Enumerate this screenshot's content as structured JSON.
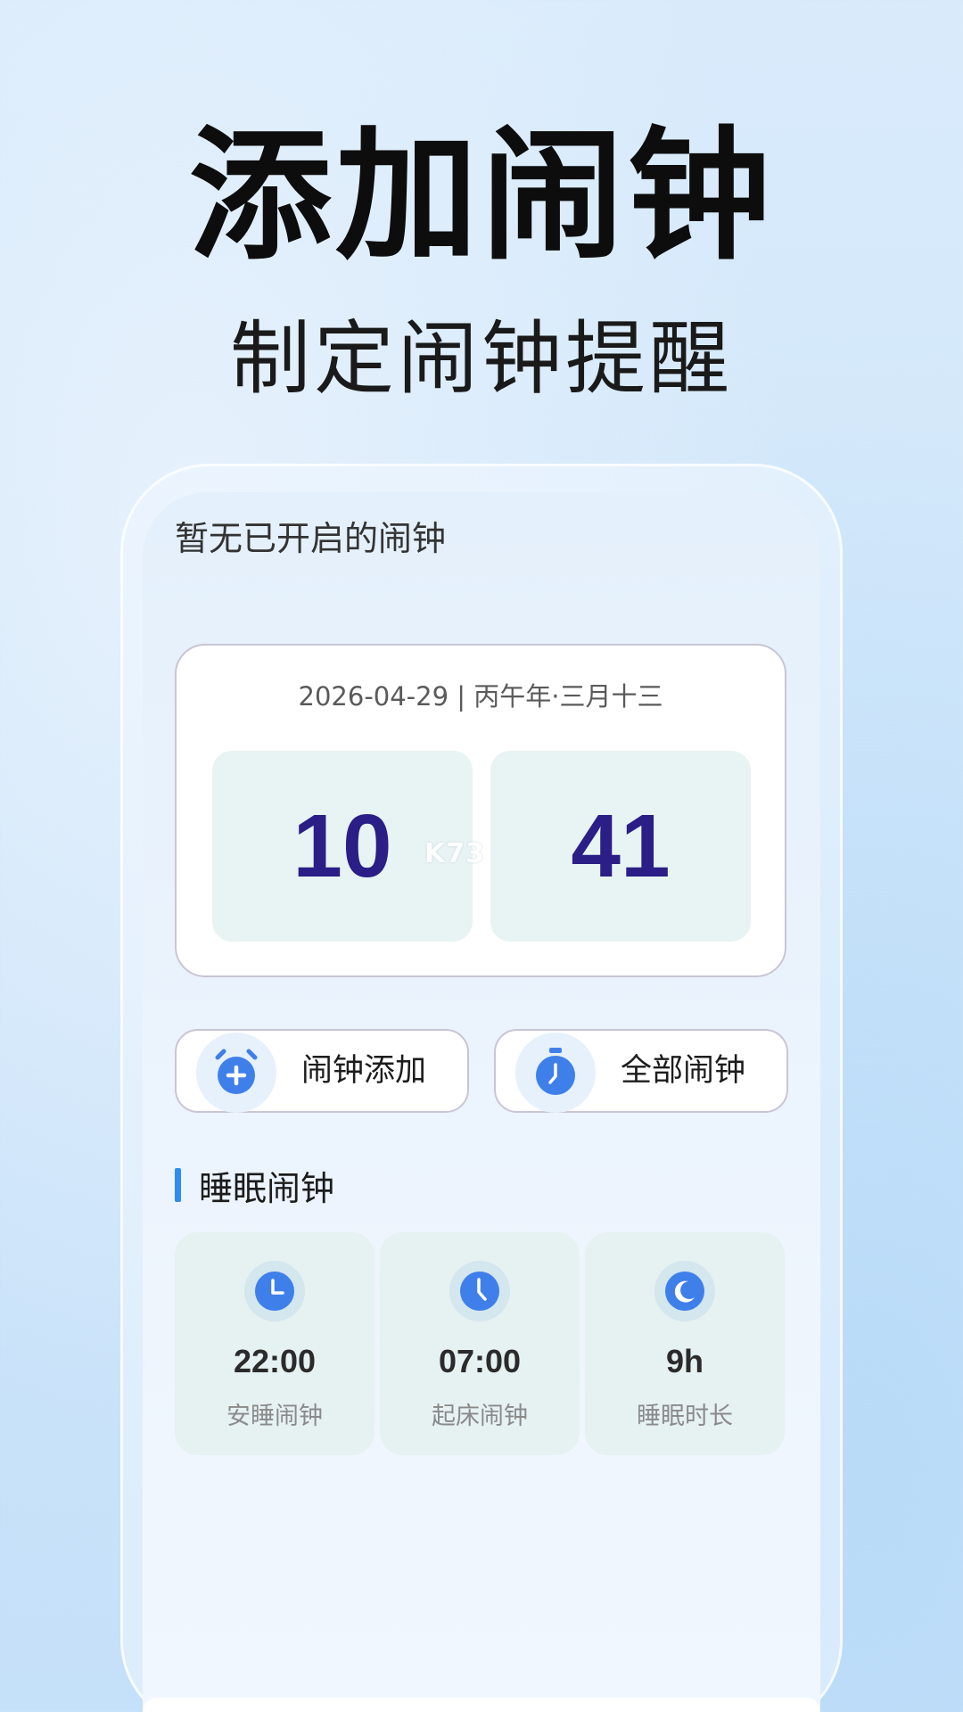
{
  "promo": {
    "headline": "添加闹钟",
    "subline": "制定闹钟提醒"
  },
  "status": {
    "text": "暂无已开启的闹钟"
  },
  "clock": {
    "date": "2026-04-29 | 丙午年·三月十三",
    "hour": "10",
    "minute": "41"
  },
  "watermark": {
    "text": "K73"
  },
  "actions": {
    "add_label": "闹钟添加",
    "all_label": "全部闹钟"
  },
  "sleep": {
    "title": "睡眠闹钟",
    "items": [
      {
        "value": "22:00",
        "label": "安睡闹钟",
        "icon": "clock-icon"
      },
      {
        "value": "07:00",
        "label": "起床闹钟",
        "icon": "clock-icon"
      },
      {
        "value": "9h",
        "label": "睡眠时长",
        "icon": "moon-icon"
      }
    ]
  },
  "colors": {
    "accent": "#3f7fea",
    "digits": "#2b1e86",
    "section_bar": "#2f8df0"
  }
}
